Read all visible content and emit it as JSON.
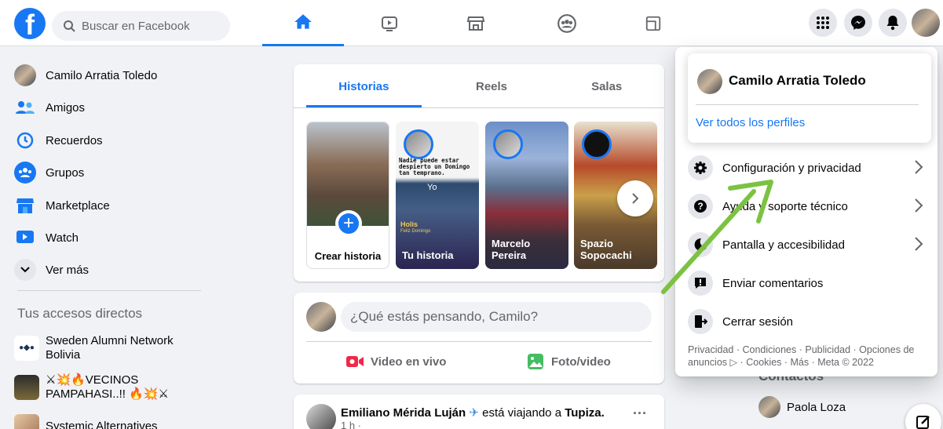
{
  "header": {
    "search_placeholder": "Buscar en Facebook"
  },
  "sidebar": {
    "items": [
      {
        "label": "Camilo Arratia Toledo"
      },
      {
        "label": "Amigos"
      },
      {
        "label": "Recuerdos"
      },
      {
        "label": "Grupos"
      },
      {
        "label": "Marketplace"
      },
      {
        "label": "Watch"
      },
      {
        "label": "Ver más"
      }
    ],
    "shortcuts_title": "Tus accesos directos",
    "shortcuts": [
      {
        "label": "Sweden Alumni Network Bolivia"
      },
      {
        "label": "⚔💥🔥VECINOS PAMPAHASI..!! 🔥💥⚔"
      },
      {
        "label": "Systemic Alternatives"
      }
    ]
  },
  "stories": {
    "tabs": [
      {
        "label": "Historias"
      },
      {
        "label": "Reels"
      },
      {
        "label": "Salas"
      }
    ],
    "cards": [
      {
        "label": "Crear historia"
      },
      {
        "label": "Tu historia",
        "caption": "Nadie puede estar despierto un Domingo tan temprano.",
        "sub": "Yo",
        "sticker": "Holis",
        "sticker_sub": "Feliz Domingo"
      },
      {
        "label": "Marcelo Pereira"
      },
      {
        "label": "Spazio Sopocachi"
      }
    ]
  },
  "composer": {
    "placeholder": "¿Qué estás pensando, Camilo?",
    "live_label": "Video en vivo",
    "photo_label": "Foto/video"
  },
  "post": {
    "author": "Emiliano Mérida Luján",
    "activity": "está viajando a",
    "place": "Tupiza.",
    "time": "1 h ·"
  },
  "contacts": {
    "title": "Contactos",
    "items": [
      {
        "name": "Paola Loza"
      }
    ]
  },
  "account_menu": {
    "profile_name": "Camilo Arratia Toledo",
    "see_all_profiles": "Ver todos los perfiles",
    "items": [
      {
        "label": "Configuración y privacidad",
        "icon": "gear-icon"
      },
      {
        "label": "Ayuda y soporte técnico",
        "icon": "help-icon"
      },
      {
        "label": "Pantalla y accesibilidad",
        "icon": "moon-icon"
      },
      {
        "label": "Enviar comentarios",
        "icon": "feedback-icon"
      },
      {
        "label": "Cerrar sesión",
        "icon": "logout-icon"
      }
    ],
    "footer": "Privacidad · Condiciones · Publicidad · Opciones de anuncios ▷ · Cookies · Más · Meta © 2022"
  },
  "colors": {
    "brand": "#1877f2",
    "annotation_arrow": "#7cc242"
  }
}
